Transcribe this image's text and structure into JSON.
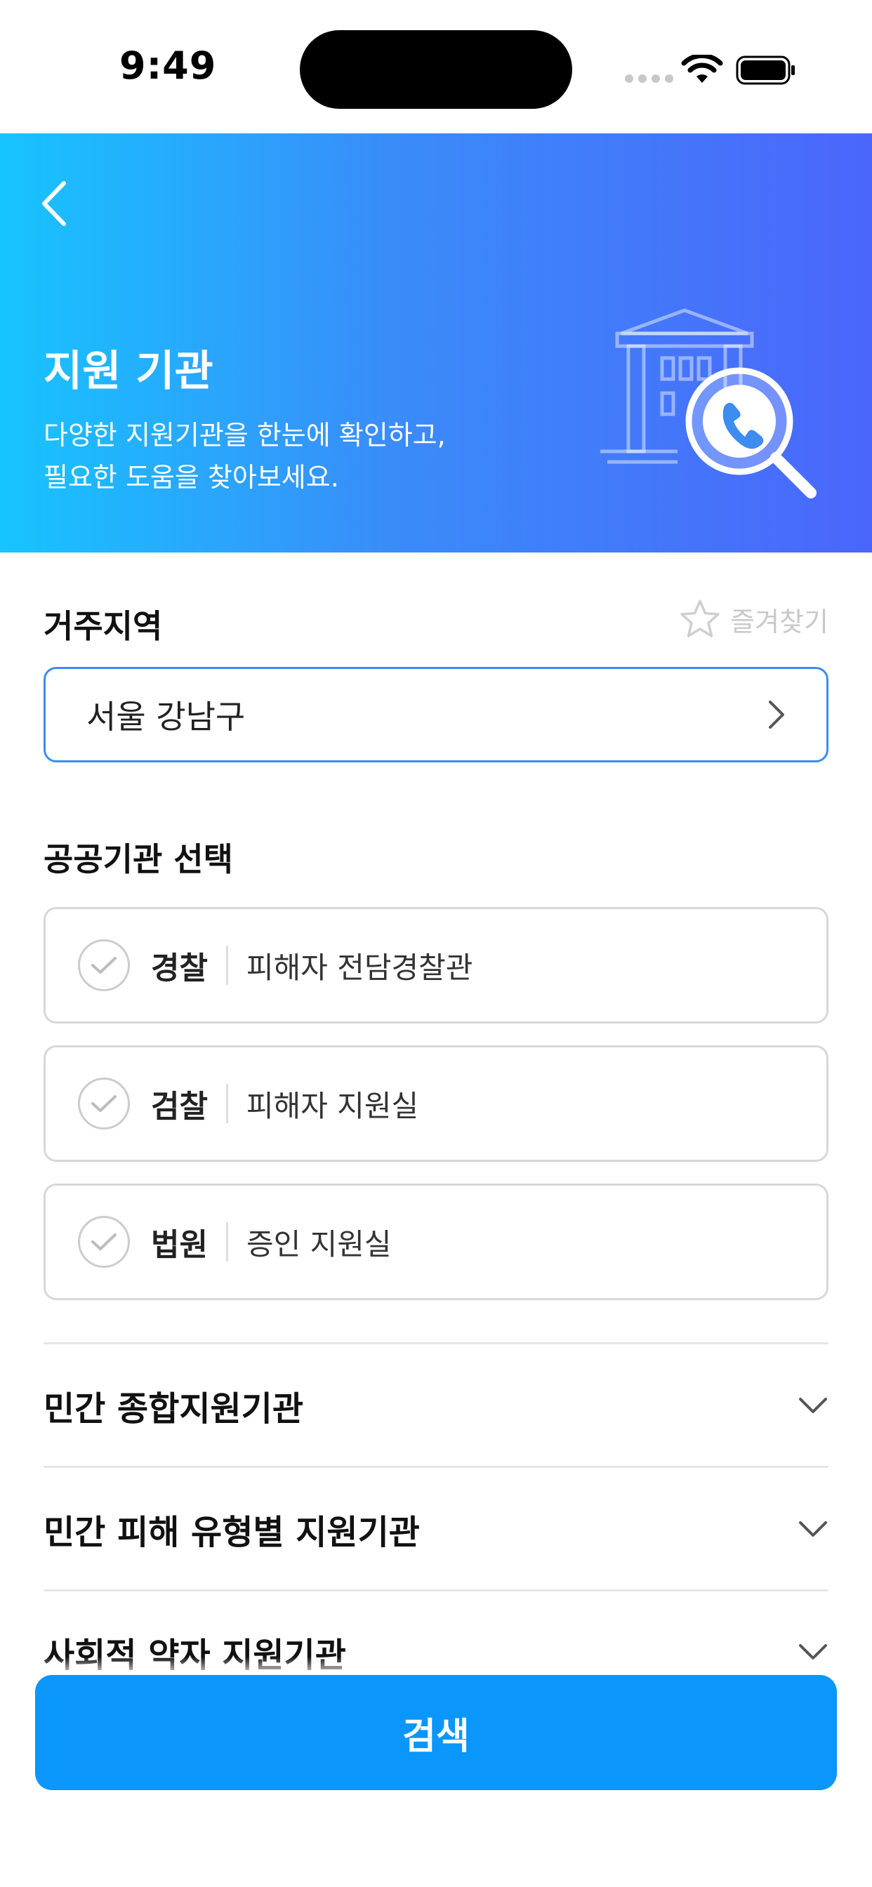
{
  "status_bar": {
    "time": "9:49"
  },
  "header": {
    "title": "지원 기관",
    "description_line1": "다양한 지원기관을 한눈에 확인하고,",
    "description_line2": "필요한 도움을 찾아보세요."
  },
  "residence": {
    "label": "거주지역",
    "favorite_label": "즐겨찾기",
    "selected_region": "서울 강남구"
  },
  "public_agencies": {
    "label": "공공기관 선택",
    "items": [
      {
        "org": "경찰",
        "desc": "피해자 전담경찰관"
      },
      {
        "org": "검찰",
        "desc": "피해자 지원실"
      },
      {
        "org": "법원",
        "desc": "증인 지원실"
      }
    ]
  },
  "accordions": [
    {
      "label": "민간 종합지원기관"
    },
    {
      "label": "민간 피해 유형별 지원기관"
    },
    {
      "label": "사회적 약자 지원기관"
    }
  ],
  "search_button": {
    "label": "검색"
  },
  "colors": {
    "accent": "#0a96fb",
    "header_gradient_start": "#17c4ff",
    "header_gradient_end": "#4b66fb",
    "select_border": "#3d8cf0"
  },
  "icons": {
    "back": "chevron-left-icon",
    "favorite": "star-outline-icon",
    "region_arrow": "chevron-right-icon",
    "check": "check-circle-icon",
    "accordion": "chevron-down-icon",
    "illustration": "building-search-phone-icon"
  }
}
